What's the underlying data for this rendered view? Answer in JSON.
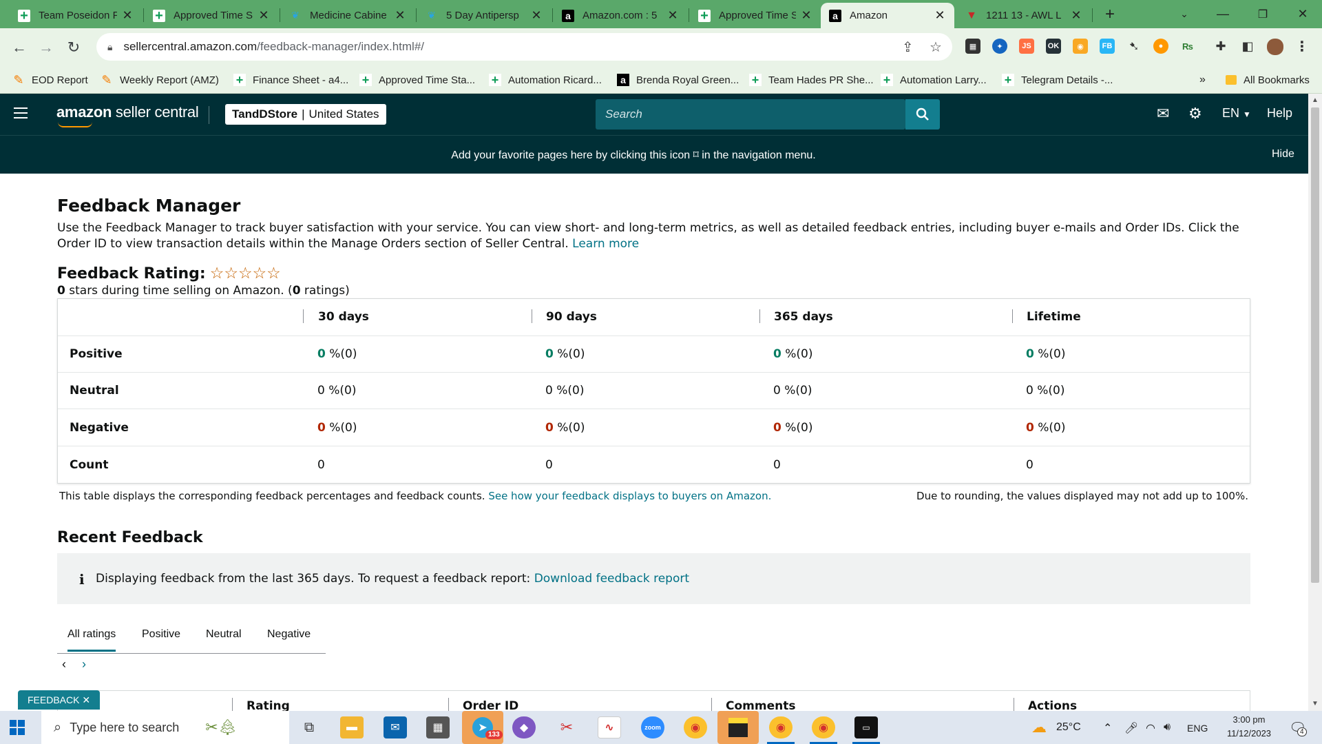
{
  "browser": {
    "tabs": [
      {
        "title": "Team Poseidon P",
        "icon": "sheets-icon"
      },
      {
        "title": "Approved Time S",
        "icon": "sheets-icon"
      },
      {
        "title": "Medicine Cabine",
        "icon": "leaf-icon"
      },
      {
        "title": "5 Day Antipersp",
        "icon": "leaf-icon"
      },
      {
        "title": "Amazon.com : 5",
        "icon": "amazon-icon"
      },
      {
        "title": "Approved Time S",
        "icon": "sheets-icon"
      },
      {
        "title": "Amazon",
        "icon": "amazon-icon"
      },
      {
        "title": "1211 13 - AWL L",
        "icon": "awl-icon"
      }
    ],
    "url_host": "sellercentral.amazon.com",
    "url_path": "/feedback-manager/index.html#/",
    "bookmarks": [
      {
        "label": "EOD Report",
        "icon": "pencil-icon"
      },
      {
        "label": "Weekly Report (AMZ)",
        "icon": "pencil-icon"
      },
      {
        "label": "Finance Sheet - a4...",
        "icon": "sheets-icon"
      },
      {
        "label": "Approved Time Sta...",
        "icon": "sheets-icon"
      },
      {
        "label": "Automation Ricard...",
        "icon": "sheets-icon"
      },
      {
        "label": "Brenda Royal Green...",
        "icon": "amazon-icon"
      },
      {
        "label": "Team Hades PR She...",
        "icon": "sheets-icon"
      },
      {
        "label": "Automation Larry...",
        "icon": "sheets-icon"
      },
      {
        "label": "Telegram Details -...",
        "icon": "sheets-icon"
      }
    ],
    "bookmarks_overflow": "»",
    "all_bookmarks": "All Bookmarks"
  },
  "header": {
    "logo_amazon": "amazon",
    "logo_rest": " seller central",
    "store_name": "TandDStore",
    "store_sep": "|",
    "store_region": "United States",
    "search_placeholder": "Search",
    "lang": "EN",
    "help": "Help",
    "banner_text": "Add your favorite pages here by clicking this icon ⌑ in the navigation menu.",
    "banner_hide": "Hide"
  },
  "page": {
    "title": "Feedback Manager",
    "intro": "Use the Feedback Manager to track buyer satisfaction with your service. You can view short- and long-term metrics, as well as detailed feedback entries, including buyer e-mails and Order IDs. Click the Order ID to view transaction details within the Manage Orders section of Seller Central.",
    "learn_more": "Learn more",
    "rating_label": "Feedback Rating:",
    "stars": "☆☆☆☆☆",
    "rating_stars_value": "0",
    "rating_mid": " stars during time selling on Amazon. (",
    "rating_count": "0",
    "rating_end": " ratings)"
  },
  "feedback_table": {
    "columns": [
      "30 days",
      "90 days",
      "365 days",
      "Lifetime"
    ],
    "rows": [
      {
        "label": "Positive",
        "values": [
          "0",
          "0",
          "0",
          "0"
        ],
        "suffix": " %(0)"
      },
      {
        "label": "Neutral",
        "values": [
          "0",
          "0",
          "0",
          "0"
        ],
        "suffix": " %(0)"
      },
      {
        "label": "Negative",
        "values": [
          "0",
          "0",
          "0",
          "0"
        ],
        "suffix": " %(0)"
      },
      {
        "label": "Count",
        "values": [
          "0",
          "0",
          "0",
          "0"
        ],
        "suffix": ""
      }
    ],
    "note_left": "This table displays the corresponding feedback percentages and feedback counts.",
    "note_left_link": "See how your feedback displays to buyers on Amazon.",
    "note_right": "Due to rounding, the values displayed may not add up to 100%."
  },
  "recent": {
    "title": "Recent Feedback",
    "info": "Displaying feedback from the last 365 days. To request a feedback report:",
    "info_link": "Download feedback report",
    "filters": [
      "All ratings",
      "Positive",
      "Neutral",
      "Negative"
    ],
    "active_filter": "All ratings",
    "columns": [
      ".",
      "Rating",
      "Order ID",
      "Comments",
      "Actions"
    ],
    "feedback_tab": "FEEDBACK ✕"
  },
  "taskbar": {
    "search_placeholder": "Type here to search",
    "weather": "25°C",
    "lang": "ENG",
    "time": "3:00 pm",
    "date": "11/12/2023",
    "telegram_badge": "133",
    "notification_count": "4"
  },
  "colors": {
    "header_bg": "#002f36",
    "positive": "#067d62",
    "negative": "#b12704",
    "link": "#007185",
    "tabstrip": "#5aa86a"
  }
}
